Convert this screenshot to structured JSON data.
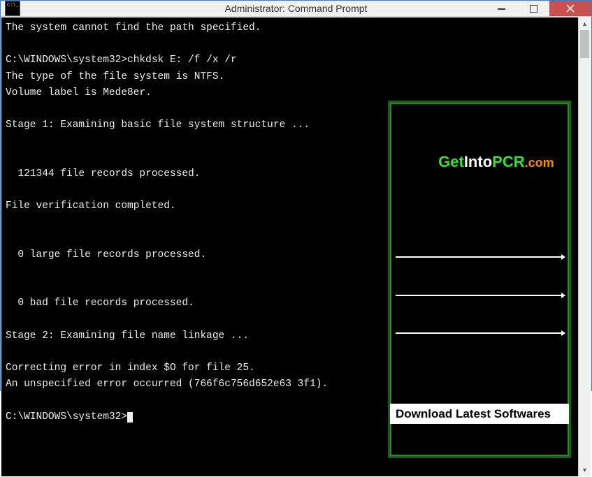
{
  "window": {
    "title": "Administrator: Command Prompt"
  },
  "terminal": {
    "lines": [
      "The system cannot find the path specified.",
      "",
      "C:\\WINDOWS\\system32>chkdsk E: /f /x /r",
      "The type of the file system is NTFS.",
      "Volume label is Mede8er.",
      "",
      "Stage 1: Examining basic file system structure ...",
      "",
      "",
      "  121344 file records processed.",
      "",
      "File verification completed.",
      "",
      "",
      "  0 large file records processed.",
      "",
      "",
      "  0 bad file records processed.",
      "",
      "Stage 2: Examining file name linkage ...",
      "",
      "Correcting error in index $O for file 25.",
      "An unspecified error occurred (766f6c756d652e63 3f1).",
      "",
      "C:\\WINDOWS\\system32>"
    ],
    "prompt_final": "C:\\WINDOWS\\system32>"
  },
  "watermark": {
    "brand_get": "Get",
    "brand_into": "Into",
    "brand_pcr": "PCR",
    "brand_com": ".com",
    "tagline": "Download Latest Softwares"
  }
}
